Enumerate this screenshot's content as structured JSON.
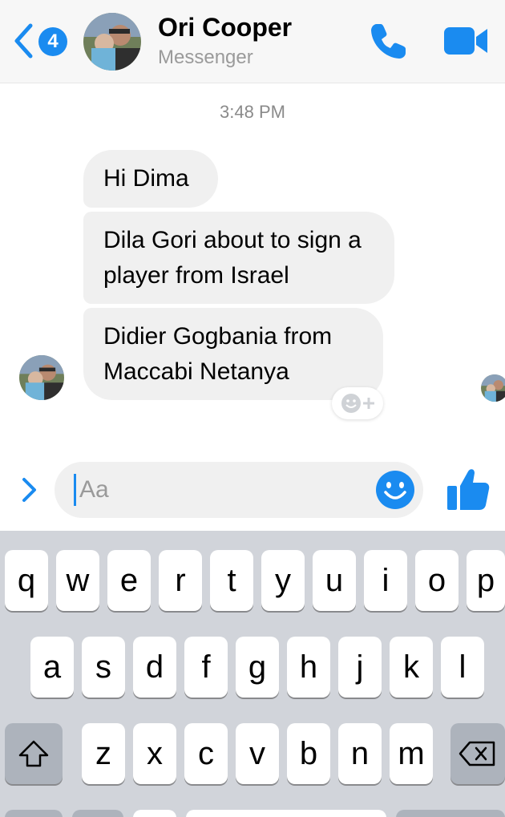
{
  "header": {
    "unread_count": "4",
    "contact_name": "Ori Cooper",
    "subtitle": "Messenger"
  },
  "chat": {
    "timestamp": "3:48 PM",
    "messages": [
      {
        "text": "Hi Dima"
      },
      {
        "text": "Dila Gori about to sign a player from Israel"
      },
      {
        "text": "Didier Gogbania from Maccabi Netanya"
      }
    ]
  },
  "composer": {
    "placeholder": "Aa"
  },
  "keyboard": {
    "row1": [
      "q",
      "w",
      "e",
      "r",
      "t",
      "y",
      "u",
      "i",
      "o",
      "p"
    ],
    "row2": [
      "a",
      "s",
      "d",
      "f",
      "g",
      "h",
      "j",
      "k",
      "l"
    ],
    "row3": [
      "z",
      "x",
      "c",
      "v",
      "b",
      "n",
      "m"
    ]
  },
  "colors": {
    "accent": "#1a8bf0",
    "bubble": "#f0f0f0",
    "keyboard_bg": "#d1d4da"
  },
  "icons": {
    "back": "chevron-left-icon",
    "call": "phone-icon",
    "video": "video-camera-icon",
    "emoji": "smiley-icon",
    "like": "thumbs-up-icon",
    "expand": "chevron-right-icon",
    "react": "add-reaction-icon",
    "shift": "shift-icon",
    "delete": "backspace-icon"
  }
}
